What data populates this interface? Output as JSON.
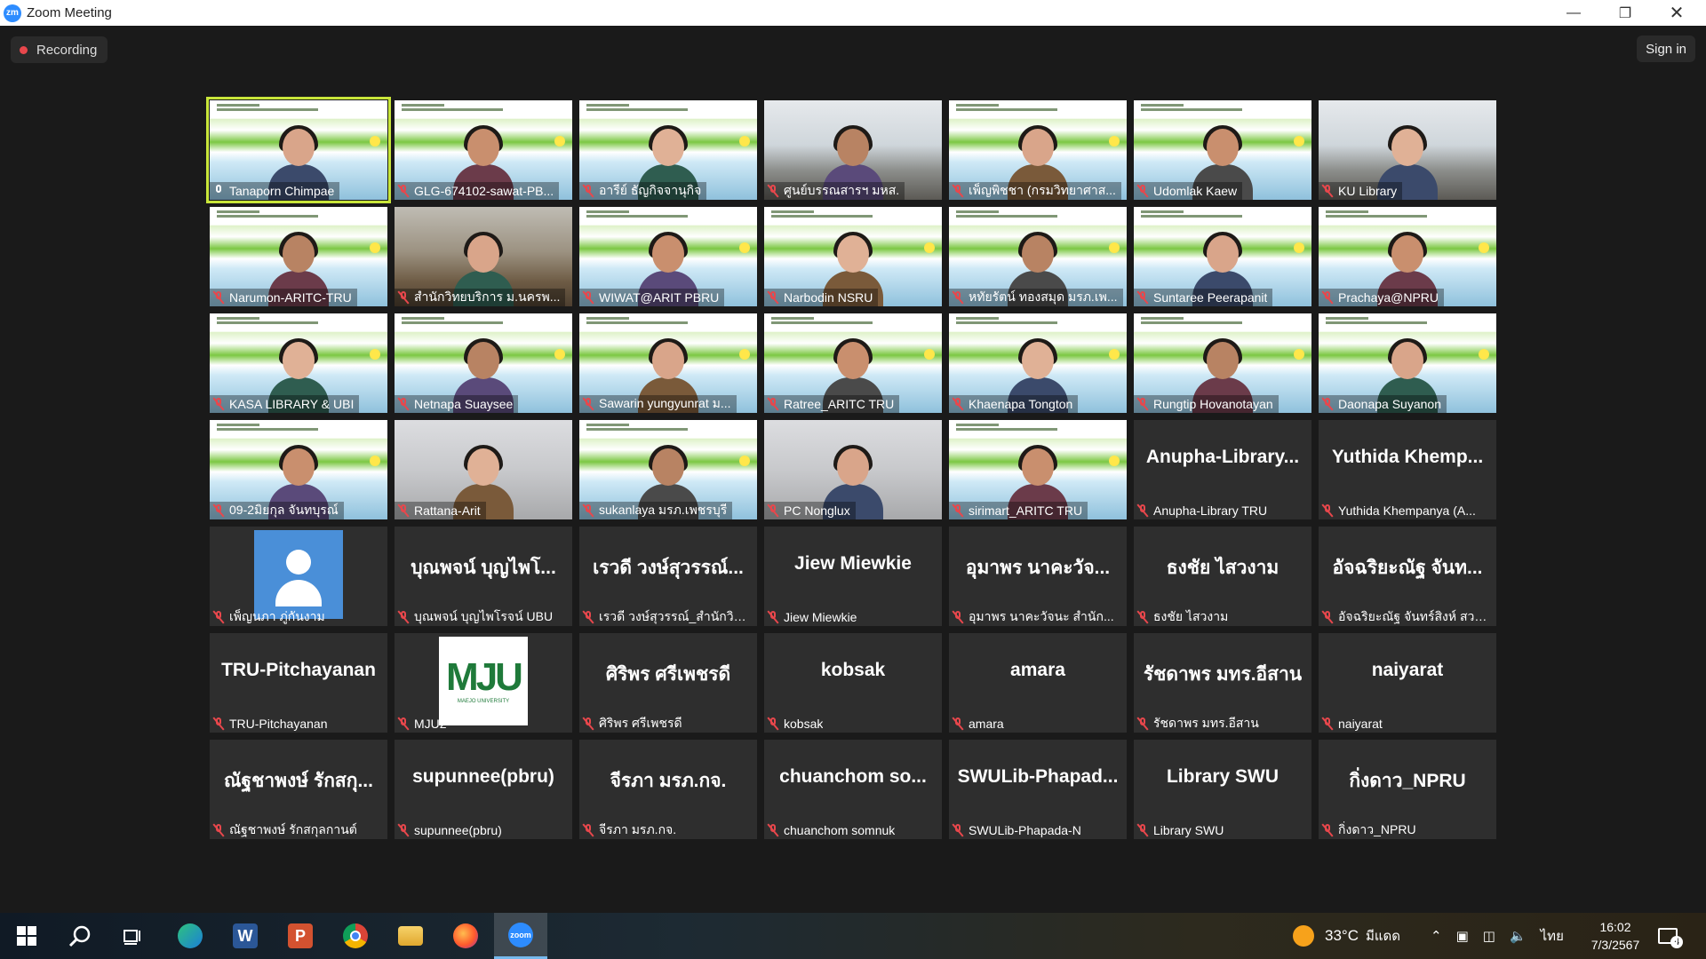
{
  "window": {
    "title": "Zoom Meeting",
    "logo": "zm"
  },
  "meeting": {
    "recording_label": "Recording",
    "signin_label": "Sign in"
  },
  "tiles": [
    {
      "name": "Tanaporn Chimpae",
      "type": "video",
      "bg": "green",
      "mic": "on",
      "active": true
    },
    {
      "name": "GLG-674102-sawat-PB...",
      "type": "video",
      "bg": "green",
      "mic": "muted"
    },
    {
      "name": "อารีย์ ธัญกิจจานุกิจ",
      "type": "video",
      "bg": "green",
      "mic": "muted"
    },
    {
      "name": "ศูนย์บรรณสารฯ มหส.",
      "type": "video",
      "bg": "office",
      "mic": "muted"
    },
    {
      "name": "เพ็ญพิชชา (กรมวิทยาศาส...",
      "type": "video",
      "bg": "green",
      "mic": "muted"
    },
    {
      "name": "Udomlak Kaew",
      "type": "video",
      "bg": "green",
      "mic": "muted"
    },
    {
      "name": "KU Library",
      "type": "video",
      "bg": "office",
      "mic": "muted"
    },
    {
      "name": "Narumon-ARITC-TRU",
      "type": "video",
      "bg": "green",
      "mic": "muted"
    },
    {
      "name": "สำนักวิทยบริการ ม.นครพ...",
      "type": "video",
      "bg": "room",
      "mic": "muted"
    },
    {
      "name": "WIWAT@ARIT PBRU",
      "type": "video",
      "bg": "green",
      "mic": "muted"
    },
    {
      "name": "Narbodin NSRU",
      "type": "video",
      "bg": "green",
      "mic": "muted"
    },
    {
      "name": "หทัยรัตน์ ทองสมุด มรภ.เพ...",
      "type": "video",
      "bg": "green",
      "mic": "muted"
    },
    {
      "name": "Suntaree Peerapanit",
      "type": "video",
      "bg": "green",
      "mic": "muted"
    },
    {
      "name": "Prachaya@NPRU",
      "type": "video",
      "bg": "green",
      "mic": "muted"
    },
    {
      "name": "KASA LIBRARY & UBI",
      "type": "video",
      "bg": "green",
      "mic": "muted"
    },
    {
      "name": "Netnapa Suaysee",
      "type": "video",
      "bg": "green",
      "mic": "muted"
    },
    {
      "name": "Sawarin yungyunrat ม...",
      "type": "video",
      "bg": "green",
      "mic": "muted"
    },
    {
      "name": "Ratree_ARITC TRU",
      "type": "video",
      "bg": "green",
      "mic": "muted"
    },
    {
      "name": "Khaenapa Tongton",
      "type": "video",
      "bg": "green",
      "mic": "muted"
    },
    {
      "name": "Rungtip Hovanotayan",
      "type": "video",
      "bg": "green",
      "mic": "muted"
    },
    {
      "name": "Daonapa Suyanon",
      "type": "video",
      "bg": "green",
      "mic": "muted"
    },
    {
      "name": "09-2มิยกุล จันทบุรณ์",
      "type": "video",
      "bg": "green",
      "mic": "muted"
    },
    {
      "name": "Rattana-Arit",
      "type": "video",
      "bg": "photo",
      "mic": "muted"
    },
    {
      "name": "sukanlaya มรภ.เพชรบุรี",
      "type": "video",
      "bg": "green",
      "mic": "muted"
    },
    {
      "name": "PC Nonglux",
      "type": "video",
      "bg": "photo",
      "mic": "muted"
    },
    {
      "name": "sirimart_ARITC TRU",
      "type": "video",
      "bg": "green",
      "mic": "muted"
    },
    {
      "name": "Anupha-Library TRU",
      "display": "Anupha-Library...",
      "type": "name",
      "mic": "muted"
    },
    {
      "name": "Yuthida Khempanya (A...",
      "display": "Yuthida Khemp...",
      "type": "name",
      "mic": "muted"
    },
    {
      "name": "เพ็ญนภา ภู่กันงาม",
      "type": "avatar",
      "mic": "muted"
    },
    {
      "name": "บุณพจน์ บุญไพโรจน์ UBU",
      "display": "บุณพจน์ บุญไพโ...",
      "type": "name",
      "mic": "muted"
    },
    {
      "name": "เรวดี วงษ์สุวรรณ์_สำนักวิท...",
      "display": "เรวดี วงษ์สุวรรณ์...",
      "type": "name",
      "mic": "muted"
    },
    {
      "name": "Jiew Miewkie",
      "display": "Jiew Miewkie",
      "type": "name",
      "mic": "muted"
    },
    {
      "name": "อุมาพร นาคะวัจนะ สำนัก...",
      "display": "อุมาพร นาคะวัจ...",
      "type": "name",
      "mic": "muted"
    },
    {
      "name": "ธงชัย ไสวงาม",
      "display": "ธงชัย ไสวงาม",
      "type": "name",
      "mic": "muted"
    },
    {
      "name": "อัจฉริยะณัฐ จันทร์สิงห์ สวท...",
      "display": "อัจฉริยะณัฐ จันท...",
      "type": "name",
      "mic": "muted"
    },
    {
      "name": "TRU-Pitchayanan",
      "display": "TRU-Pitchayanan",
      "type": "name",
      "mic": "muted"
    },
    {
      "name": "MJU2",
      "type": "logo",
      "logo_text": "MJU",
      "logo_sub": "MAEJO UNIVERSITY",
      "mic": "muted"
    },
    {
      "name": "ศิริพร ศรีเพชรดี",
      "display": "ศิริพร ศรีเพชรดี",
      "type": "name",
      "mic": "muted"
    },
    {
      "name": "kobsak",
      "display": "kobsak",
      "type": "name",
      "mic": "muted"
    },
    {
      "name": "amara",
      "display": "amara",
      "type": "name",
      "mic": "muted"
    },
    {
      "name": "รัชดาพร มทร.อีสาน",
      "display": "รัชดาพร มทร.อีสาน",
      "type": "name",
      "mic": "muted"
    },
    {
      "name": "naiyarat",
      "display": "naiyarat",
      "type": "name",
      "mic": "muted"
    },
    {
      "name": "ณัฐชาพงษ์ รักสกุลกานต์",
      "display": "ณัฐชาพงษ์ รักสกุ...",
      "type": "name",
      "mic": "muted"
    },
    {
      "name": "supunnee(pbru)",
      "display": "supunnee(pbru)",
      "type": "name",
      "mic": "muted"
    },
    {
      "name": "จีรภา มรภ.กจ.",
      "display": "จีรภา มรภ.กจ.",
      "type": "name",
      "mic": "muted"
    },
    {
      "name": "chuanchom somnuk",
      "display": "chuanchom so...",
      "type": "name",
      "mic": "muted"
    },
    {
      "name": "SWULib-Phapada-N",
      "display": "SWULib-Phapad...",
      "type": "name",
      "mic": "muted"
    },
    {
      "name": "Library SWU",
      "display": "Library SWU",
      "type": "name",
      "mic": "muted"
    },
    {
      "name": "กิ่งดาว_NPRU",
      "display": "กิ่งดาว_NPRU",
      "type": "name",
      "mic": "muted"
    }
  ],
  "taskbar": {
    "apps": [
      "start-icon",
      "search-icon",
      "task-view-icon",
      "edge-icon",
      "word-icon",
      "powerpoint-icon",
      "chrome-icon",
      "file-explorer-icon",
      "firefox-icon",
      "zoom-icon"
    ],
    "active_app": "zoom-icon",
    "weather": {
      "temp": "33°C",
      "condition": "มีแดด"
    },
    "language": "ไทย",
    "time": "16:02",
    "date": "7/3/2567",
    "notification_count": "4"
  },
  "colors": {
    "active_speaker": "#c9e63a",
    "recording_dot": "#e8474c",
    "muted_mic": "#e8474c"
  }
}
